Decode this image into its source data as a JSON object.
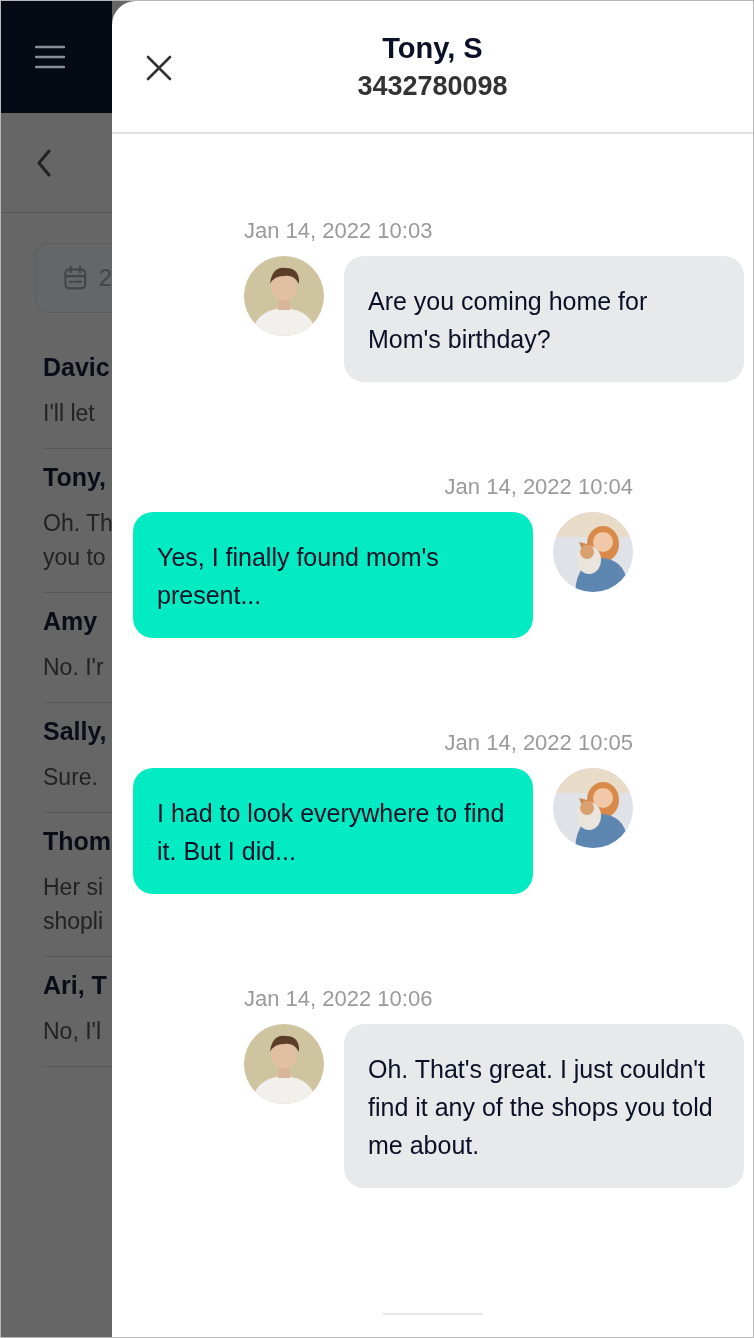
{
  "background": {
    "date_field": {
      "value": "2"
    },
    "conversations": [
      {
        "name": "Davic",
        "preview": [
          "I'll let"
        ]
      },
      {
        "name": "Tony,",
        "preview": [
          "Oh. Th",
          "you to"
        ]
      },
      {
        "name": "Amy",
        "preview": [
          "No. I'r"
        ]
      },
      {
        "name": "Sally,",
        "preview": [
          "Sure."
        ]
      },
      {
        "name": "Thom",
        "preview": [
          "Her si",
          "shopli"
        ]
      },
      {
        "name": "Ari, T",
        "preview": [
          "No, I'l"
        ]
      }
    ]
  },
  "drawer": {
    "title": "Tony, S",
    "subtitle": "3432780098",
    "messages": [
      {
        "kind": "incoming",
        "time": "Jan 14, 2022 10:03",
        "text": "Are you coming home for Mom's birthday?"
      },
      {
        "kind": "outgoing",
        "time": "Jan 14, 2022 10:04",
        "text": "Yes, I finally found mom's present..."
      },
      {
        "kind": "outgoing",
        "time": "Jan 14, 2022 10:05",
        "text": "I had to look everywhere to find it. But I did..."
      },
      {
        "kind": "incoming",
        "time": "Jan 14, 2022 10:06",
        "text": "Oh. That's great. I just couldn't find it any of the shops you told me about."
      }
    ]
  }
}
